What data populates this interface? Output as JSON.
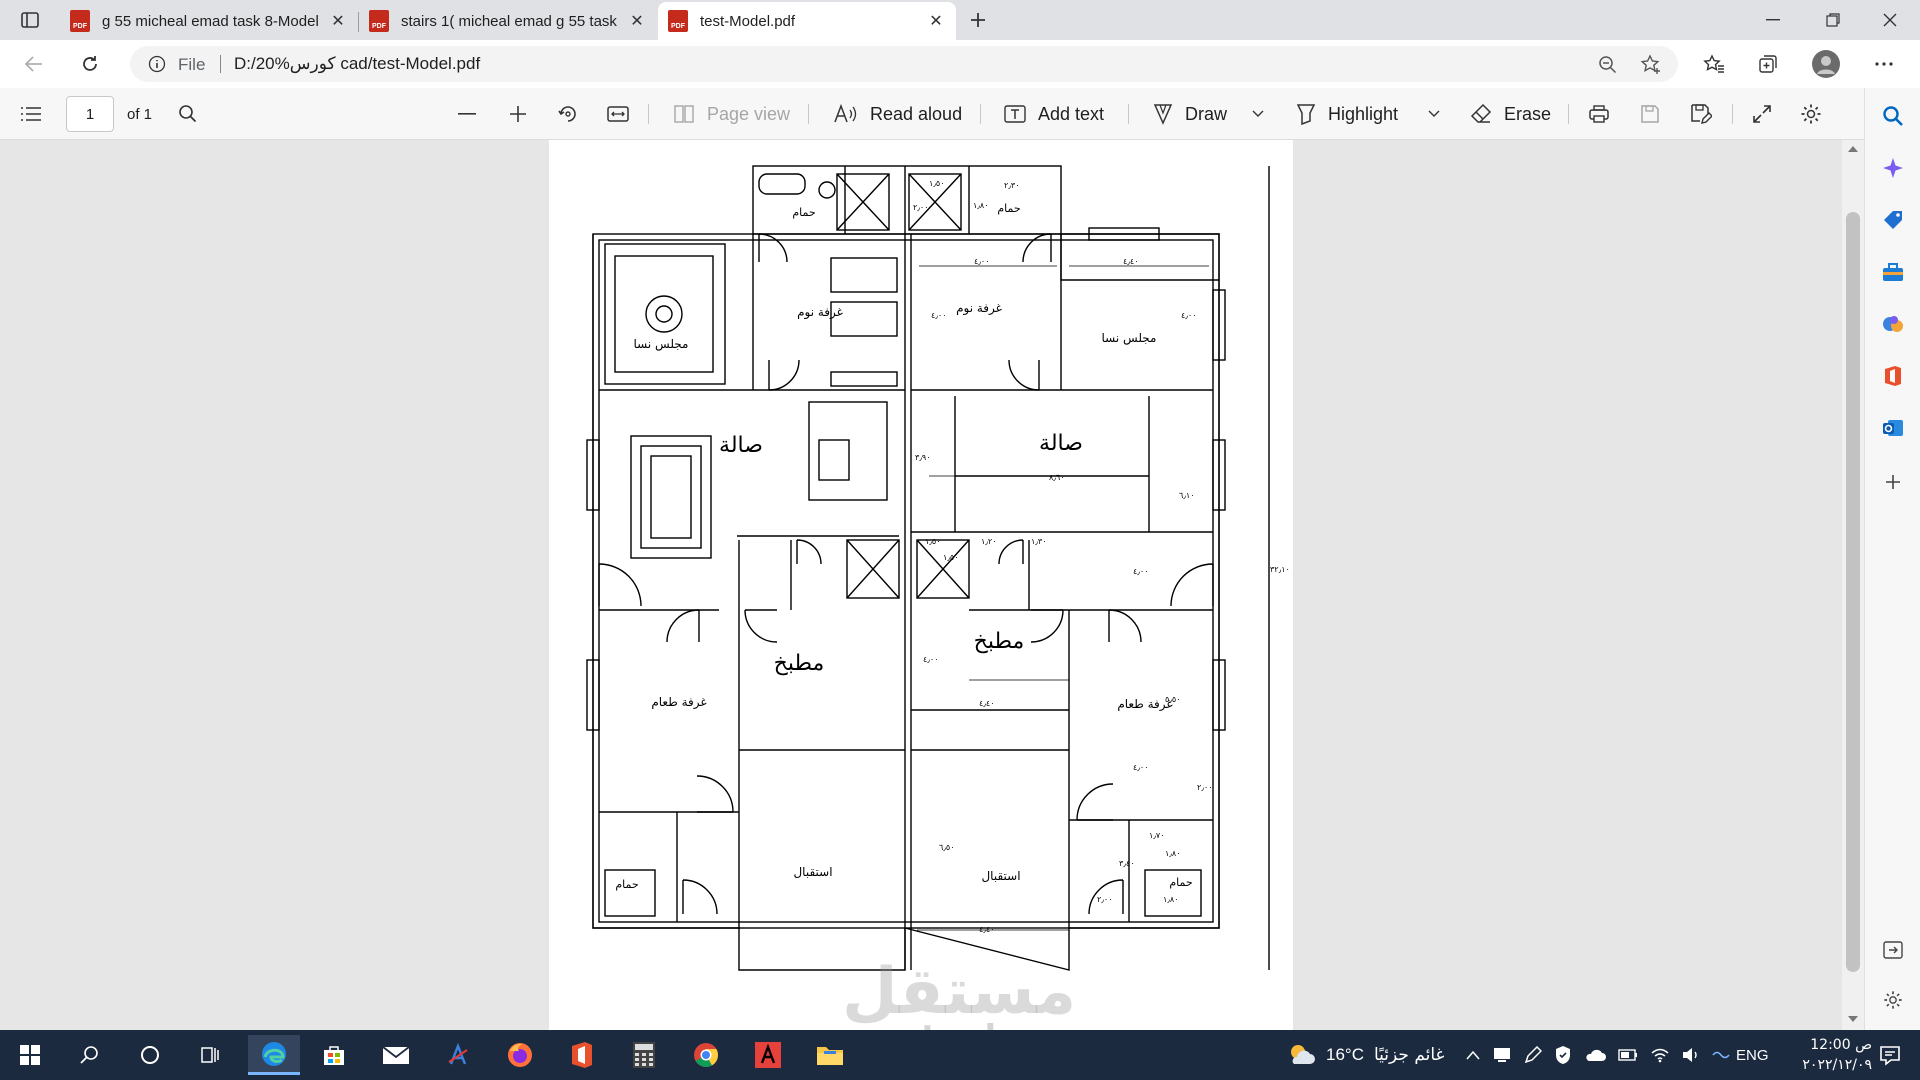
{
  "browser": {
    "tabs": [
      {
        "title": "g 55 micheal emad task 8-Model",
        "active": false
      },
      {
        "title": "stairs 1( micheal emad g 55 task",
        "active": false
      },
      {
        "title": "test-Model.pdf",
        "active": true
      }
    ],
    "new_tab_icon": "plus-icon",
    "address": {
      "scheme_label": "File",
      "url": "D:/20%كورس cad/test-Model.pdf"
    }
  },
  "pdf_toolbar": {
    "page_current": "1",
    "page_total": "of 1",
    "page_view": "Page view",
    "read_aloud": "Read aloud",
    "add_text": "Add text",
    "draw": "Draw",
    "highlight": "Highlight",
    "erase": "Erase"
  },
  "floor_plan": {
    "rooms": {
      "majlis_left": "مجلس نسا",
      "majlis_right": "مجلس نسا",
      "bedroom_left": "غرفة نوم",
      "bedroom_right": "غرفة نوم",
      "bath_top_left": "حمام",
      "bath_top_right": "حمام",
      "hall_left": "صالة",
      "hall_right": "صالة",
      "kitchen_left": "مطبخ",
      "kitchen_right": "مطبخ",
      "dining_left": "غرفة طعام",
      "dining_right": "غرفة طعام",
      "reception_left": "استقبال",
      "reception_right": "استقبال",
      "bath_bottom_left": "حمام",
      "bath_bottom_right": "حمام"
    },
    "dimensions": {
      "overall": "٣٢٫١٠",
      "d_top1": "٢٫٣٠",
      "d_top2": "١٫٥٠",
      "d_top3": "٢٫٠٠",
      "d_top4": "١٫٨٠",
      "d_room1": "٤٫٠٠",
      "d_room2": "٤٫٤٠",
      "d_room3": "٤٫٠٠",
      "d_room4": "٤٫٠٠",
      "d_hall1": "٣٫٩٠",
      "d_hall2": "٨٫٦٠",
      "d_hall3": "٦٫١٠",
      "d_stair1": "١٫٥٠",
      "d_stair2": "١٫٢٠",
      "d_stair3": "١٫٣٠",
      "d_stair4": "١٫٥٠",
      "d_k1": "٤٫٠٠",
      "d_k2": "٤٫٠٠",
      "d_k3": "٤٫٤٠",
      "d_k4": "٥٫٥٠",
      "d_k5": "٤٫٠٠",
      "d_k6": "٢٫٠٠",
      "d_r1": "٦٫٥٠",
      "d_r2": "١٫٧٠",
      "d_r3": "١٫٨٠",
      "d_r4": "٣٫٤٠",
      "d_r5": "٢٫٠٠",
      "d_r6": "١٫٨٠",
      "d_r7": "٤٫٤٠"
    }
  },
  "watermark": {
    "arabic": "مستقل",
    "latin": "mostaql.com"
  },
  "taskbar": {
    "weather_temp": "16°C",
    "weather_text": "غائم جزئيًا",
    "language": "ENG",
    "time": "12:00 ص",
    "date": "٢٠٢٢/١٢/٠٩"
  },
  "colors": {
    "accent": "#0067c0",
    "pdf_red": "#c42b1c",
    "taskbar": "#1c2a3f"
  }
}
